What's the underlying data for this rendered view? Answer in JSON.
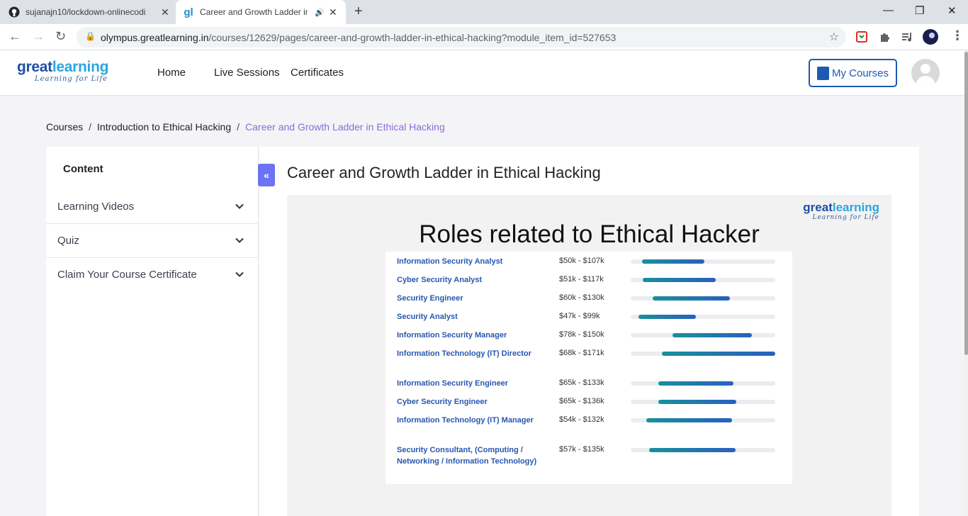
{
  "browser": {
    "tabs": [
      {
        "title": "sujanajn10/lockdown-onlinecodi"
      },
      {
        "title": "Career and Growth Ladder in Eth"
      }
    ],
    "url_host": "olympus.greatlearning.in",
    "url_path": "/courses/12629/pages/career-and-growth-ladder-in-ethical-hacking?module_item_id=527653"
  },
  "header": {
    "logo_part1": "great",
    "logo_part2": "learning",
    "logo_tagline": "Learning for Life",
    "nav": [
      "Home",
      "Live Sessions",
      "Certificates"
    ],
    "my_courses": "My Courses"
  },
  "breadcrumb": [
    "Courses",
    "Introduction to Ethical Hacking",
    "Career and Growth Ladder in Ethical Hacking"
  ],
  "sidebar": {
    "title": "Content",
    "sections": [
      "Learning Videos",
      "Quiz",
      "Claim Your Course Certificate"
    ]
  },
  "page": {
    "title": "Career and Growth Ladder in Ethical Hacking"
  },
  "slide": {
    "logo_part1": "great",
    "logo_part2": "learning",
    "logo_tagline": "Learning for Life",
    "heading": "Roles related to Ethical Hacker",
    "roles": [
      {
        "role": "Information Security Analyst",
        "salary": "$50k - $107k",
        "min": 50,
        "max": 107
      },
      {
        "role": "Cyber Security Analyst",
        "salary": "$51k - $117k",
        "min": 51,
        "max": 117
      },
      {
        "role": "Security Engineer",
        "salary": "$60k - $130k",
        "min": 60,
        "max": 130
      },
      {
        "role": "Security Analyst",
        "salary": "$47k - $99k",
        "min": 47,
        "max": 99
      },
      {
        "role": "Information Security Manager",
        "salary": "$78k - $150k",
        "min": 78,
        "max": 150
      },
      {
        "role": "Information Technology (IT) Director",
        "salary": "$68k - $171k",
        "min": 68,
        "max": 171
      },
      {
        "role": "Information Security Engineer",
        "salary": "$65k - $133k",
        "min": 65,
        "max": 133
      },
      {
        "role": "Cyber Security Engineer",
        "salary": "$65k - $136k",
        "min": 65,
        "max": 136
      },
      {
        "role": "Information Technology (IT) Manager",
        "salary": "$54k - $132k",
        "min": 54,
        "max": 132
      },
      {
        "role": "Security Consultant, (Computing / Networking / Information Technology)",
        "salary": "$57k - $135k",
        "min": 57,
        "max": 135
      }
    ]
  }
}
